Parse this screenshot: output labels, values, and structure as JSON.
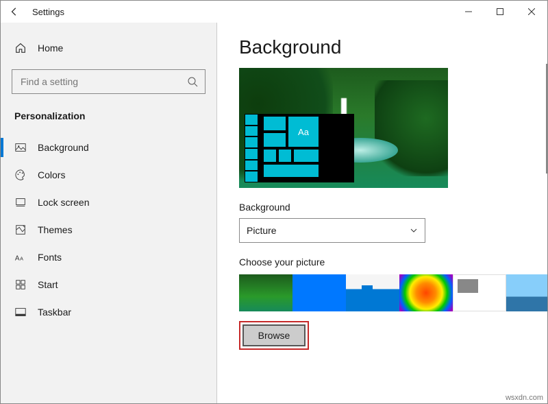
{
  "window": {
    "title": "Settings"
  },
  "sidebar": {
    "home": "Home",
    "search_placeholder": "Find a setting",
    "section": "Personalization",
    "items": [
      {
        "label": "Background",
        "icon": "picture-icon",
        "active": true
      },
      {
        "label": "Colors",
        "icon": "palette-icon"
      },
      {
        "label": "Lock screen",
        "icon": "lock-screen-icon"
      },
      {
        "label": "Themes",
        "icon": "themes-icon"
      },
      {
        "label": "Fonts",
        "icon": "fonts-icon"
      },
      {
        "label": "Start",
        "icon": "start-icon"
      },
      {
        "label": "Taskbar",
        "icon": "taskbar-icon"
      }
    ]
  },
  "main": {
    "heading": "Background",
    "preview_sample_text": "Aa",
    "background_label": "Background",
    "background_value": "Picture",
    "choose_label": "Choose your picture",
    "browse_label": "Browse"
  },
  "footer": "wsxdn.com"
}
